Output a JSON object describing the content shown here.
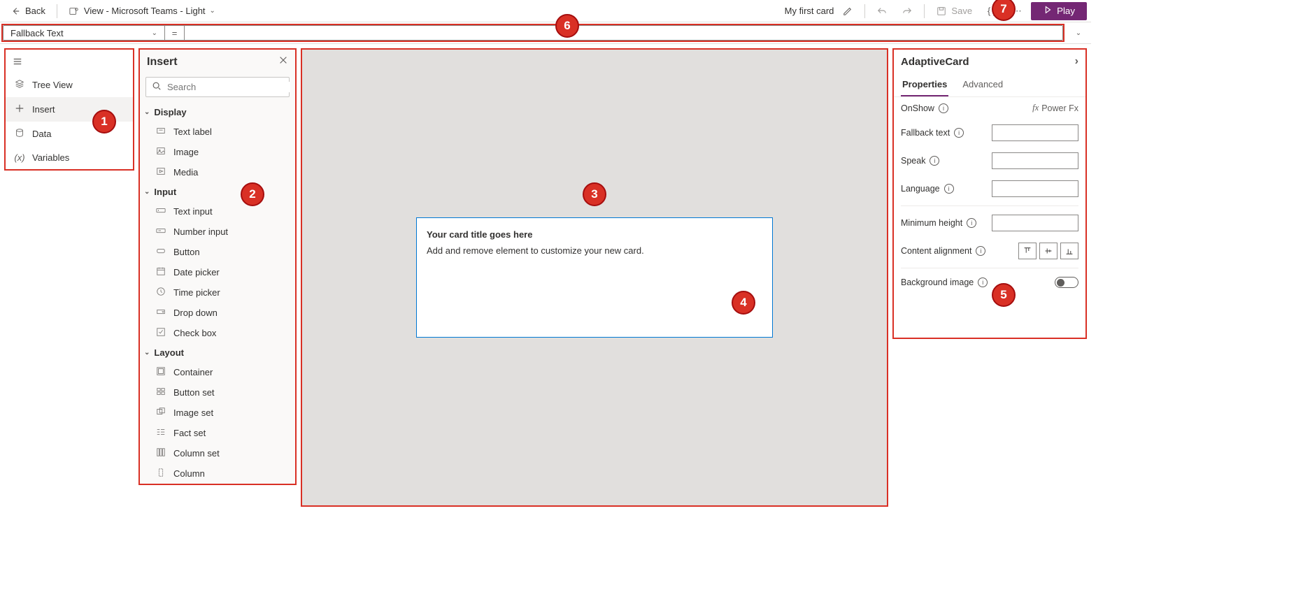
{
  "topbar": {
    "back": "Back",
    "view_label": "View - Microsoft Teams - Light",
    "card_name": "My first card",
    "save": "Save",
    "play": "Play"
  },
  "formula": {
    "property": "Fallback Text",
    "eq": "=",
    "value": ""
  },
  "left_rail": [
    "Tree View",
    "Insert",
    "Data",
    "Variables"
  ],
  "insert": {
    "title": "Insert",
    "search_ph": "Search",
    "groups": [
      {
        "name": "Display",
        "items": [
          "Text label",
          "Image",
          "Media"
        ]
      },
      {
        "name": "Input",
        "items": [
          "Text input",
          "Number input",
          "Button",
          "Date picker",
          "Time picker",
          "Drop down",
          "Check box"
        ]
      },
      {
        "name": "Layout",
        "items": [
          "Container",
          "Button set",
          "Image set",
          "Fact set",
          "Column set",
          "Column"
        ]
      }
    ]
  },
  "card": {
    "title": "Your card title goes here",
    "subtitle": "Add and remove element to customize your new card."
  },
  "props": {
    "title": "AdaptiveCard",
    "tabs": [
      "Properties",
      "Advanced"
    ],
    "onshow": "OnShow",
    "powerfx": "Power Fx",
    "fallback": "Fallback text",
    "speak": "Speak",
    "language": "Language",
    "minheight": "Minimum height",
    "contentalign": "Content alignment",
    "bgimage": "Background image"
  },
  "callouts": {
    "1": "1",
    "2": "2",
    "3": "3",
    "4": "4",
    "5": "5",
    "6": "6",
    "7": "7"
  }
}
